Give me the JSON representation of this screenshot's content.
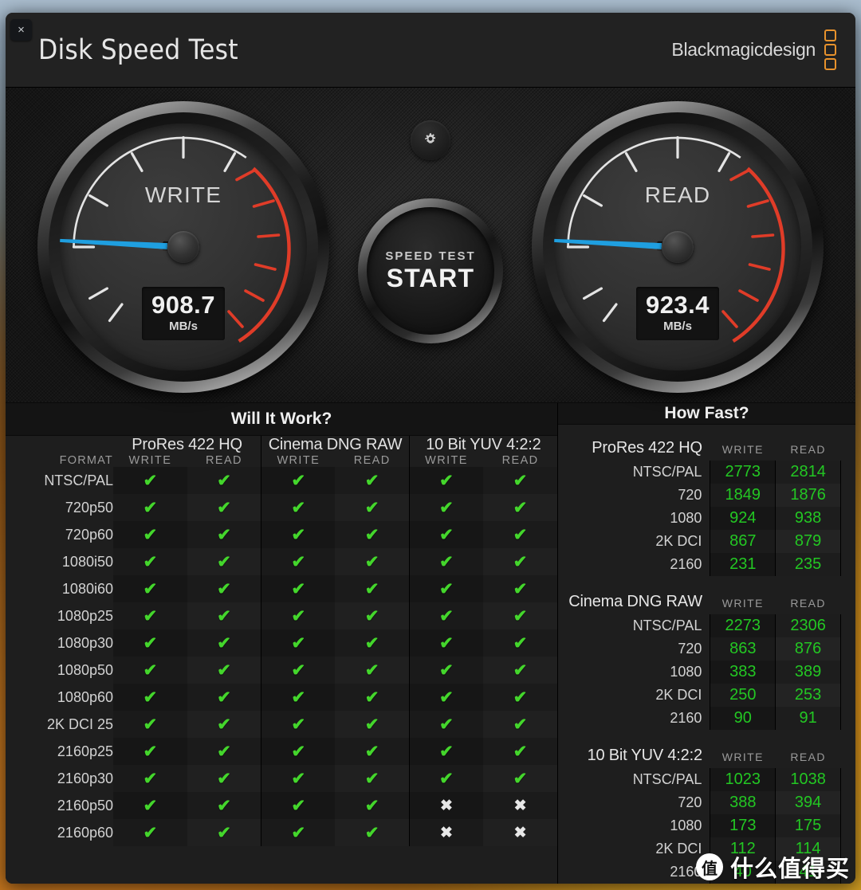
{
  "window": {
    "close_label": "×"
  },
  "titlebar": {
    "title": "Disk Speed Test",
    "brand": "Blackmagicdesign"
  },
  "gauges": {
    "write": {
      "label": "WRITE",
      "value": "908.7",
      "unit": "MB/s",
      "needle_deg": 183
    },
    "read": {
      "label": "READ",
      "value": "923.4",
      "unit": "MB/s",
      "needle_deg": 183
    }
  },
  "center": {
    "gear_icon": "gear-icon",
    "start_sub": "SPEED TEST",
    "start_main": "START"
  },
  "will_it_work": {
    "title": "Will It Work?",
    "format_header": "FORMAT",
    "groups": [
      "ProRes 422 HQ",
      "Cinema DNG RAW",
      "10 Bit YUV 4:2:2"
    ],
    "sub_headers": [
      "WRITE",
      "READ"
    ],
    "check_glyph": "✔",
    "cross_glyph": "✖",
    "rows": [
      {
        "format": "NTSC/PAL",
        "cells": [
          true,
          true,
          true,
          true,
          true,
          true
        ]
      },
      {
        "format": "720p50",
        "cells": [
          true,
          true,
          true,
          true,
          true,
          true
        ]
      },
      {
        "format": "720p60",
        "cells": [
          true,
          true,
          true,
          true,
          true,
          true
        ]
      },
      {
        "format": "1080i50",
        "cells": [
          true,
          true,
          true,
          true,
          true,
          true
        ]
      },
      {
        "format": "1080i60",
        "cells": [
          true,
          true,
          true,
          true,
          true,
          true
        ]
      },
      {
        "format": "1080p25",
        "cells": [
          true,
          true,
          true,
          true,
          true,
          true
        ]
      },
      {
        "format": "1080p30",
        "cells": [
          true,
          true,
          true,
          true,
          true,
          true
        ]
      },
      {
        "format": "1080p50",
        "cells": [
          true,
          true,
          true,
          true,
          true,
          true
        ]
      },
      {
        "format": "1080p60",
        "cells": [
          true,
          true,
          true,
          true,
          true,
          true
        ]
      },
      {
        "format": "2K DCI 25",
        "cells": [
          true,
          true,
          true,
          true,
          true,
          true
        ]
      },
      {
        "format": "2160p25",
        "cells": [
          true,
          true,
          true,
          true,
          true,
          true
        ]
      },
      {
        "format": "2160p30",
        "cells": [
          true,
          true,
          true,
          true,
          true,
          true
        ]
      },
      {
        "format": "2160p50",
        "cells": [
          true,
          true,
          true,
          true,
          false,
          false
        ]
      },
      {
        "format": "2160p60",
        "cells": [
          true,
          true,
          true,
          true,
          false,
          false
        ]
      }
    ]
  },
  "how_fast": {
    "title": "How Fast?",
    "sub_headers": [
      "WRITE",
      "READ"
    ],
    "sections": [
      {
        "name": "ProRes 422 HQ",
        "rows": [
          {
            "label": "NTSC/PAL",
            "write": "2773",
            "read": "2814"
          },
          {
            "label": "720",
            "write": "1849",
            "read": "1876"
          },
          {
            "label": "1080",
            "write": "924",
            "read": "938"
          },
          {
            "label": "2K DCI",
            "write": "867",
            "read": "879"
          },
          {
            "label": "2160",
            "write": "231",
            "read": "235"
          }
        ]
      },
      {
        "name": "Cinema DNG RAW",
        "rows": [
          {
            "label": "NTSC/PAL",
            "write": "2273",
            "read": "2306"
          },
          {
            "label": "720",
            "write": "863",
            "read": "876"
          },
          {
            "label": "1080",
            "write": "383",
            "read": "389"
          },
          {
            "label": "2K DCI",
            "write": "250",
            "read": "253"
          },
          {
            "label": "2160",
            "write": "90",
            "read": "91"
          }
        ]
      },
      {
        "name": "10 Bit YUV 4:2:2",
        "rows": [
          {
            "label": "NTSC/PAL",
            "write": "1023",
            "read": "1038"
          },
          {
            "label": "720",
            "write": "388",
            "read": "394"
          },
          {
            "label": "1080",
            "write": "173",
            "read": "175"
          },
          {
            "label": "2K DCI",
            "write": "112",
            "read": "114"
          },
          {
            "label": "2160",
            "write": "40",
            "read": "41"
          }
        ]
      }
    ]
  },
  "watermark": {
    "logo_char": "值",
    "text": "什么值得买"
  },
  "colors": {
    "accent_needle": "#1f9fe0",
    "brand_orange": "#e8922c",
    "check_green": "#44d62c",
    "value_green": "#23c723",
    "redline": "#e03c28"
  }
}
